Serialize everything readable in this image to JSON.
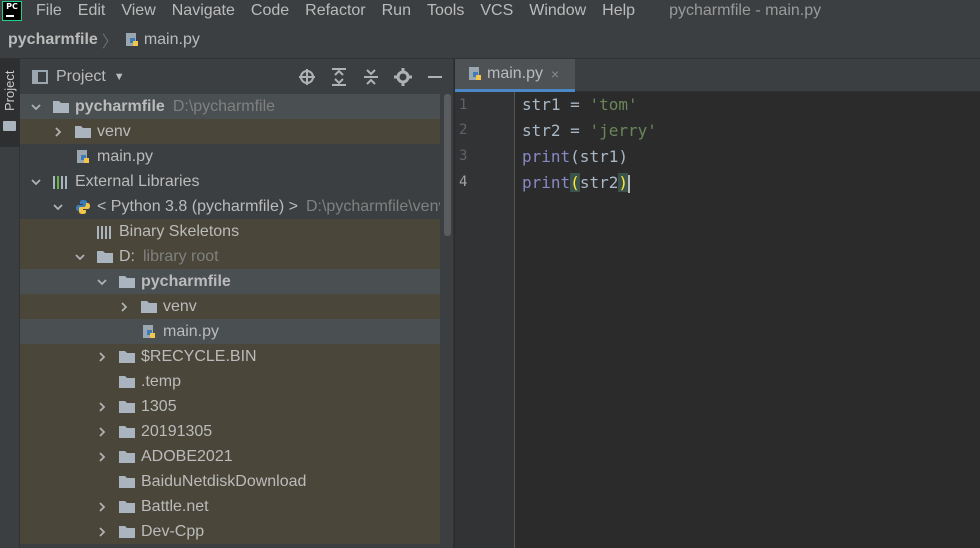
{
  "menubar": {
    "logo": "PC",
    "items": [
      "File",
      "Edit",
      "View",
      "Navigate",
      "Code",
      "Refactor",
      "Run",
      "Tools",
      "VCS",
      "Window",
      "Help"
    ],
    "window_title": "pycharmfile - main.py"
  },
  "navbar": {
    "project": "pycharmfile",
    "file": "main.py"
  },
  "toolstrip": {
    "tab_label": "Project"
  },
  "project_panel": {
    "title": "Project",
    "rows": [
      {
        "label": "pycharmfile",
        "suffix": "D:\\pycharmfile"
      },
      {
        "label": "venv"
      },
      {
        "label": "main.py"
      },
      {
        "label": "External Libraries"
      },
      {
        "label": "< Python 3.8 (pycharmfile) >",
        "suffix": "D:\\pycharmfile\\venv"
      },
      {
        "label": "Binary Skeletons"
      },
      {
        "label": "D:",
        "suffix": "library root"
      },
      {
        "label": "pycharmfile"
      },
      {
        "label": "venv"
      },
      {
        "label": "main.py"
      },
      {
        "label": "$RECYCLE.BIN"
      },
      {
        "label": ".temp"
      },
      {
        "label": "1305"
      },
      {
        "label": "20191305"
      },
      {
        "label": "ADOBE2021"
      },
      {
        "label": "BaiduNetdiskDownload"
      },
      {
        "label": "Battle.net"
      },
      {
        "label": "Dev-Cpp"
      }
    ]
  },
  "editor": {
    "tab": {
      "label": "main.py",
      "close": "×"
    },
    "line_numbers": [
      "1",
      "2",
      "3",
      "4"
    ],
    "code": {
      "l1_var": "str1 = ",
      "l1_str": "'tom'",
      "l2_var": "str2 = ",
      "l2_str": "'jerry'",
      "l3_fn": "print",
      "l3_args": "(str1)",
      "l4_fn": "print",
      "l4_open": "(",
      "l4_arg": "str2",
      "l4_close": ")"
    }
  }
}
